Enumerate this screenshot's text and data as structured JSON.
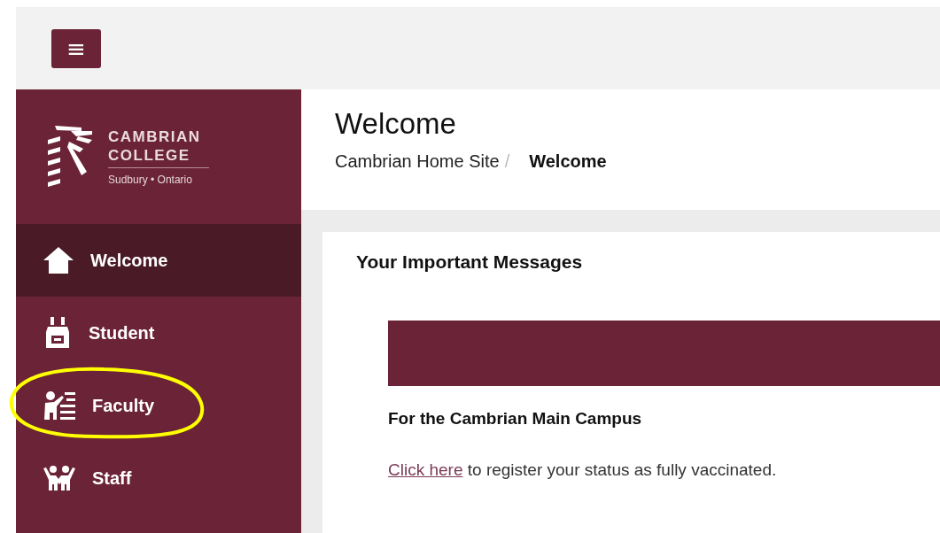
{
  "top_bar": {
    "menu_button": "≡"
  },
  "logo": {
    "line_1": "CAMBRIAN",
    "line_2": "COLLEGE",
    "tagline": "Sudbury • Ontario"
  },
  "sidebar": {
    "items": [
      {
        "label": "Welcome",
        "selected": true,
        "highlighted": false
      },
      {
        "label": "Student",
        "selected": false,
        "highlighted": false
      },
      {
        "label": "Faculty",
        "selected": false,
        "highlighted": true
      },
      {
        "label": "Staff",
        "selected": false,
        "highlighted": false
      }
    ]
  },
  "header": {
    "title": "Welcome",
    "breadcrumb": [
      {
        "label": "Cambrian Home Site",
        "current": false
      },
      {
        "label": "Welcome",
        "current": true
      }
    ],
    "separator": "/"
  },
  "card": {
    "title": "Your Important Messages",
    "subtitle": "For the Cambrian Main Campus",
    "link": "Click here",
    "text": " to register your status as fully vaccinated."
  }
}
